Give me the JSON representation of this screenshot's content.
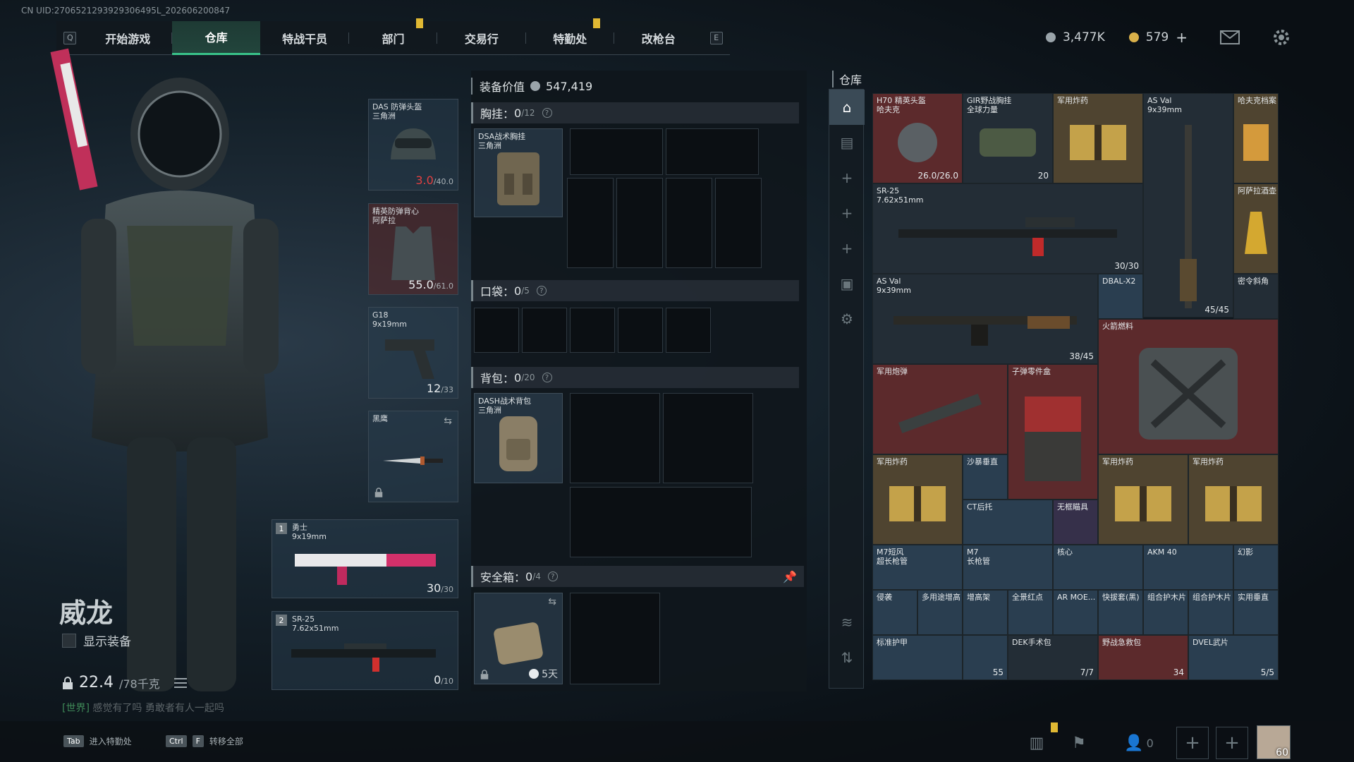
{
  "uid": "CN UID:2706521293929306495L_202606200847",
  "nav": {
    "left_key": "Q",
    "right_key": "E",
    "tabs": [
      {
        "label": "开始游戏"
      },
      {
        "label": "仓库"
      },
      {
        "label": "特战干员"
      },
      {
        "label": "部门"
      },
      {
        "label": "交易行"
      },
      {
        "label": "特勤处"
      },
      {
        "label": "改枪台"
      }
    ],
    "currency1": "3,477K",
    "currency2": "579",
    "plus": "+"
  },
  "character": {
    "name": "威龙",
    "show_equipment": "显示装备",
    "weight": "22.4",
    "weight_max": "/78千克",
    "chat": "[世界]",
    "chat_msg": "感觉有了吗 勇敢者有人一起吗"
  },
  "slots": {
    "helmet": {
      "label": "DAS 防弹头盔\n三角洲",
      "value": "3.0",
      "max": "/40.0"
    },
    "armor": {
      "label": "精英防弹背心\n阿萨拉",
      "value": "55.0",
      "max": "/61.0"
    },
    "pistol": {
      "label": "G18\n9x19mm",
      "value": "12",
      "max": "/33"
    },
    "melee": {
      "label": "黑鹰"
    },
    "primary1": {
      "num": "1",
      "label": "勇士\n9x19mm",
      "value": "30",
      "max": "/30"
    },
    "primary2": {
      "num": "2",
      "label": "SR-25\n7.62x51mm",
      "value": "0",
      "max": "/10"
    }
  },
  "middle": {
    "equip_value_label": "装备价值",
    "equip_value": "547,419",
    "chest": {
      "label": "胸挂：",
      "count": "0",
      "max": "/12",
      "item": "DSA战术胸挂\n三角洲"
    },
    "pocket": {
      "label": "口袋：",
      "count": "0",
      "max": "/5"
    },
    "backpack": {
      "label": "背包：",
      "count": "0",
      "max": "/20",
      "item": "DASH战术背包\n三角洲"
    },
    "safebox": {
      "label": "安全箱：",
      "count": "0",
      "max": "/4",
      "days": "5天"
    },
    "qmark": "?"
  },
  "warehouse": {
    "title": "仓库",
    "items": [
      {
        "label": "H70 精英头盔\n哈夫克",
        "count": "26.0/26.0"
      },
      {
        "label": "GIR野战胸挂\n全球力量",
        "count": "20"
      },
      {
        "label": "军用炸药",
        "count": ""
      },
      {
        "label": "AS Val\n9x39mm",
        "count": ""
      },
      {
        "label": "哈夫克档案",
        "count": ""
      },
      {
        "label": "SR-25\n7.62x51mm",
        "count": "30/30"
      },
      {
        "label": "阿萨拉酒壶",
        "count": ""
      },
      {
        "label": "AS Val\n9x39mm",
        "count": "38/45"
      },
      {
        "label": "DBAL-X2",
        "count": ""
      },
      {
        "label": "",
        "count": "45/45"
      },
      {
        "label": "密令斜角",
        "count": ""
      },
      {
        "label": "火箭燃料",
        "count": ""
      },
      {
        "label": "军用炮弹",
        "count": ""
      },
      {
        "label": "子弹零件盒",
        "count": ""
      },
      {
        "label": "军用炸药",
        "count": ""
      },
      {
        "label": "沙暴垂直",
        "count": ""
      },
      {
        "label": "CT后托",
        "count": ""
      },
      {
        "label": "无框瞄具",
        "count": ""
      },
      {
        "label": "军用炸药",
        "count": ""
      },
      {
        "label": "军用炸药",
        "count": ""
      },
      {
        "label": "M7短风\n超长枪管",
        "count": ""
      },
      {
        "label": "M7\n长枪管",
        "count": ""
      },
      {
        "label": "核心",
        "count": ""
      },
      {
        "label": "AKM 40",
        "count": ""
      },
      {
        "label": "幻影",
        "count": ""
      },
      {
        "label": "侵袭",
        "count": ""
      },
      {
        "label": "多用途增高",
        "count": ""
      },
      {
        "label": "增高架",
        "count": ""
      },
      {
        "label": "全景红点",
        "count": ""
      },
      {
        "label": "AR MOE...",
        "count": ""
      },
      {
        "label": "快拔套(黑)",
        "count": ""
      },
      {
        "label": "组合护木片",
        "count": ""
      },
      {
        "label": "组合护木片",
        "count": ""
      },
      {
        "label": "实用垂直",
        "count": ""
      },
      {
        "label": "标准护甲",
        "count": ""
      },
      {
        "label": "",
        "count": "55"
      },
      {
        "label": "DEK手术包",
        "count": "7/7"
      },
      {
        "label": "野战急救包",
        "count": "34"
      },
      {
        "label": "DVEL武片",
        "count": "5/5"
      }
    ]
  },
  "bottom": {
    "btn1_key": "Tab",
    "btn1_label": "进入特勤处",
    "btn2_key1": "Ctrl",
    "btn2_key2": "F",
    "btn2_label": "转移全部",
    "friends": "0",
    "level": "60"
  },
  "colors": {
    "accent": "#39c38a",
    "red": "#e24040",
    "gold": "#e0b833"
  }
}
